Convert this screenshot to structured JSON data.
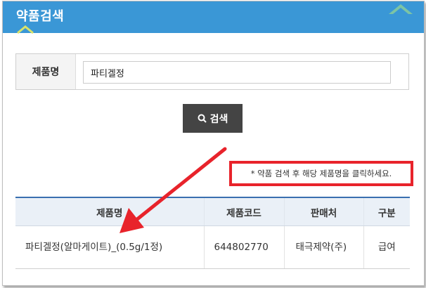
{
  "header": {
    "title": "약품검색"
  },
  "search": {
    "label": "제품명",
    "value": "파티겔정",
    "button_label": "검색"
  },
  "notice": "* 약품 검색 후 해당 제품명을 클릭하세요.",
  "table": {
    "columns": [
      "제품명",
      "제품코드",
      "판매처",
      "구분"
    ],
    "rows": [
      {
        "name": "파티겔정(알마게이트)_(0.5g/1정)",
        "code": "644802770",
        "maker": "태극제약(주)",
        "type": "급여"
      }
    ]
  },
  "colors": {
    "header": "#3a97d6",
    "annotation": "#e8232b",
    "button": "#444444",
    "table_header_bg": "#eaf0f7"
  },
  "icons": [
    "chevron-up-icon",
    "search-icon",
    "annotation-arrow"
  ]
}
